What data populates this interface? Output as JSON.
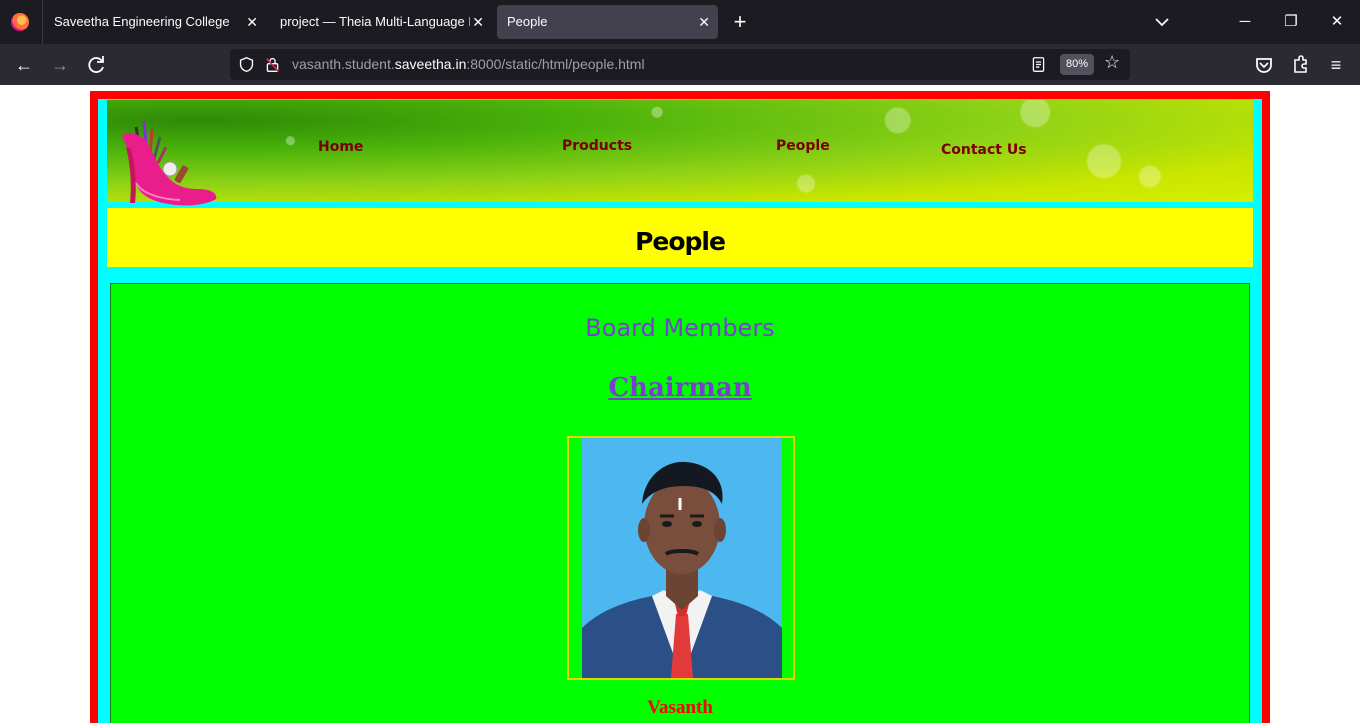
{
  "browser": {
    "tabs": [
      {
        "label": "Saveetha Engineering College",
        "active": false
      },
      {
        "label": "project — Theia Multi-Language Exp",
        "active": false
      },
      {
        "label": "People",
        "active": true
      }
    ],
    "new_tab_label": "+",
    "url_prefix": "vasanth.student.",
    "url_domain": "saveetha.in",
    "url_suffix": ":8000/static/html/people.html",
    "zoom": "80%"
  },
  "site": {
    "nav": {
      "home": "Home",
      "products": "Products",
      "people": "People",
      "contact": "Contact Us"
    },
    "page_title": "People",
    "board_title": "Board Members",
    "role": "Chairman",
    "person_name": "Vasanth"
  },
  "colors": {
    "frame": "#ff0000",
    "inner": "#00ffff",
    "title_band": "#ffff00",
    "panel": "#00ff00",
    "heading": "#7a3fcf",
    "nav_text": "#7a0000"
  }
}
